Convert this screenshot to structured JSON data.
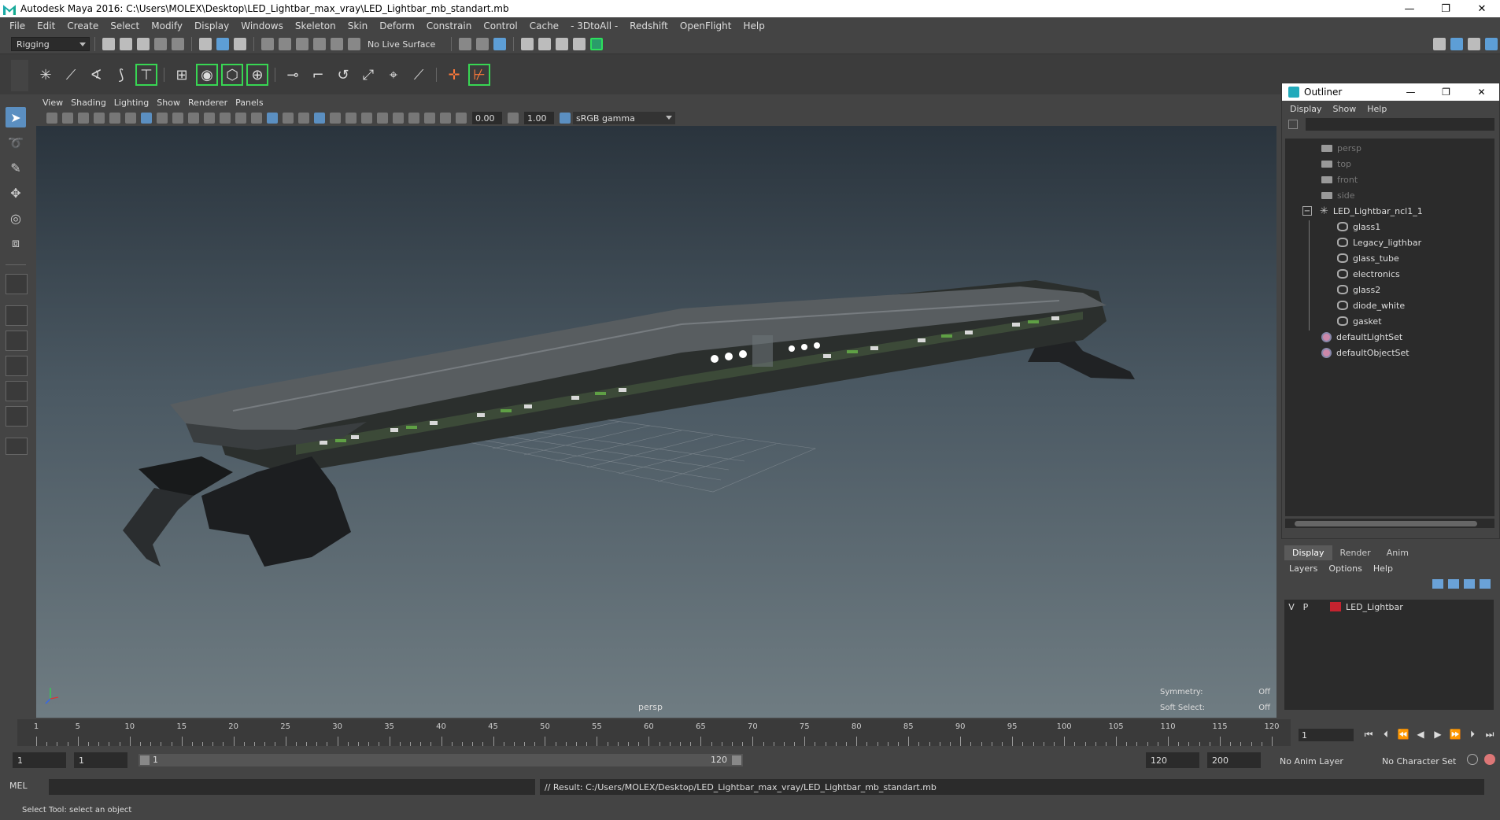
{
  "window": {
    "title": "Autodesk Maya 2016: C:\\Users\\MOLEX\\Desktop\\LED_Lightbar_max_vray\\LED_Lightbar_mb_standart.mb",
    "minimize": "—",
    "restore": "❐",
    "close": "✕"
  },
  "menubar": [
    "File",
    "Edit",
    "Create",
    "Select",
    "Modify",
    "Display",
    "Windows",
    "Skeleton",
    "Skin",
    "Deform",
    "Constrain",
    "Control",
    "Cache",
    "- 3DtoAll -",
    "Redshift",
    "OpenFlight",
    "Help"
  ],
  "statusline": {
    "menuset": "Rigging",
    "live_surface": "No Live Surface"
  },
  "viewport": {
    "menus": [
      "View",
      "Shading",
      "Lighting",
      "Show",
      "Renderer",
      "Panels"
    ],
    "near_value": "0.00",
    "far_value": "1.00",
    "color_space": "sRGB gamma",
    "camera_label": "persp",
    "hud": {
      "symmetry_label": "Symmetry:",
      "symmetry_value": "Off",
      "soft_select_label": "Soft Select:",
      "soft_select_value": "Off"
    }
  },
  "outliner": {
    "title": "Outliner",
    "menus": [
      "Display",
      "Show",
      "Help"
    ],
    "items": [
      {
        "label": "persp",
        "kind": "camera",
        "dim": true
      },
      {
        "label": "top",
        "kind": "camera",
        "dim": true
      },
      {
        "label": "front",
        "kind": "camera",
        "dim": true
      },
      {
        "label": "side",
        "kind": "camera",
        "dim": true
      },
      {
        "label": "LED_Lightbar_ncl1_1",
        "kind": "group",
        "dim": false
      },
      {
        "label": "glass1",
        "kind": "mesh",
        "dim": false
      },
      {
        "label": "Legacy_ligthbar",
        "kind": "mesh",
        "dim": false
      },
      {
        "label": "glass_tube",
        "kind": "mesh",
        "dim": false
      },
      {
        "label": "electronics",
        "kind": "mesh",
        "dim": false
      },
      {
        "label": "glass2",
        "kind": "mesh",
        "dim": false
      },
      {
        "label": "diode_white",
        "kind": "mesh",
        "dim": false
      },
      {
        "label": "gasket",
        "kind": "mesh",
        "dim": false
      },
      {
        "label": "defaultLightSet",
        "kind": "set",
        "dim": false
      },
      {
        "label": "defaultObjectSet",
        "kind": "set",
        "dim": false
      }
    ]
  },
  "layer_editor": {
    "tabs": [
      "Display",
      "Render",
      "Anim"
    ],
    "active_tab": "Display",
    "menus": [
      "Layers",
      "Options",
      "Help"
    ],
    "layers": [
      {
        "visible": "V",
        "playback": "P",
        "name": "LED_Lightbar",
        "color": "#c4232f"
      }
    ]
  },
  "timeslider": {
    "ticks": [
      1,
      5,
      10,
      15,
      20,
      25,
      30,
      35,
      40,
      45,
      50,
      55,
      60,
      65,
      70,
      75,
      80,
      85,
      90,
      95,
      100,
      105,
      110,
      115,
      120
    ],
    "current_frame": "1"
  },
  "rangeslider": {
    "start_time": "1",
    "playback_start": "1",
    "range_start": "1",
    "range_end": "120",
    "playback_end": "120",
    "end_time": "200",
    "anim_layer": "No Anim Layer",
    "character_set": "No Character Set"
  },
  "commandline": {
    "mode": "MEL",
    "result": "// Result: C:/Users/MOLEX/Desktop/LED_Lightbar_max_vray/LED_Lightbar_mb_standart.mb"
  },
  "helpline": "Select Tool: select an object",
  "colors": {
    "accent": "#5b8fc1",
    "highlight_green": "#2de05c",
    "layer_red": "#c4232f"
  }
}
